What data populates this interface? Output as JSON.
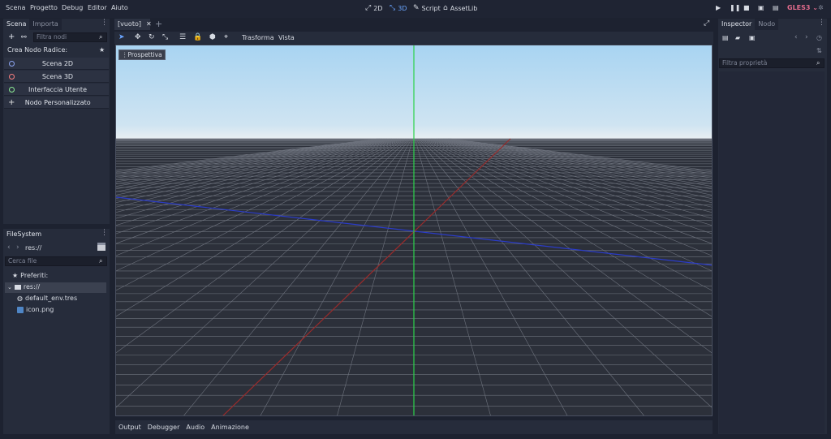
{
  "menu": [
    "Scena",
    "Progetto",
    "Debug",
    "Editor",
    "Aiuto"
  ],
  "workspaces": [
    {
      "label": "2D",
      "icon": "2d-icon"
    },
    {
      "label": "3D",
      "icon": "3d-icon"
    },
    {
      "label": "Script",
      "icon": "script-icon"
    },
    {
      "label": "AssetLib",
      "icon": "assetlib-icon"
    }
  ],
  "renderer": "GLES3",
  "scene_dock": {
    "tabs": [
      "Scena",
      "Importa"
    ],
    "filter_placeholder": "Filtra nodi",
    "create_root_label": "Crea Nodo Radice:",
    "options": [
      {
        "label": "Scena 2D",
        "color": "#8da5f3"
      },
      {
        "label": "Scena 3D",
        "color": "#fc7f7f"
      },
      {
        "label": "Interfaccia Utente",
        "color": "#8eef97"
      },
      {
        "label": "Nodo Personalizzato",
        "color": "#e0e0e0"
      }
    ]
  },
  "filesystem": {
    "tab": "FileSystem",
    "path": "res://",
    "search_placeholder": "Cerca file",
    "favorites_label": "Preferiti:",
    "root_label": "res://",
    "files": [
      "default_env.tres",
      "icon.png"
    ]
  },
  "editor": {
    "scene_tab": "[vuoto]",
    "toolbar_menus": [
      "Trasforma",
      "Vista"
    ],
    "view_label": "Prospettiva"
  },
  "bottom_panel": [
    "Output",
    "Debugger",
    "Audio",
    "Animazione"
  ],
  "inspector": {
    "tabs": [
      "Inspector",
      "Nodo"
    ],
    "filter_placeholder": "Filtra proprietà"
  }
}
